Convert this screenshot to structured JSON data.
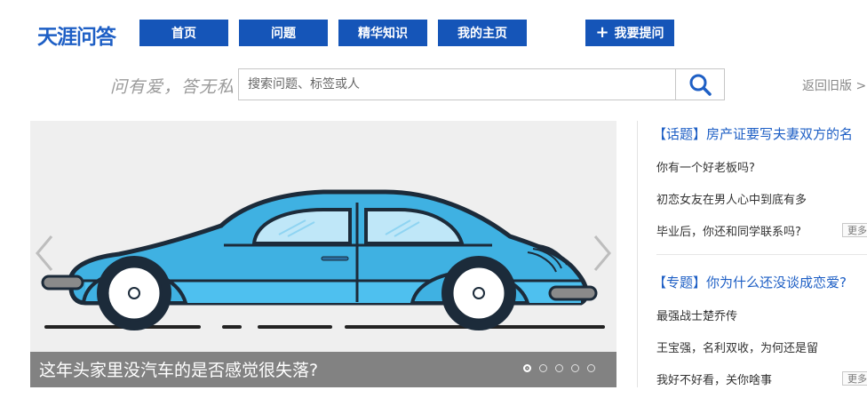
{
  "logo": "天涯问答",
  "nav": {
    "home": "首页",
    "questions": "问题",
    "featured": "精华知识",
    "my_home": "我的主页",
    "ask": "我要提问",
    "ask_icon": "plus-icon"
  },
  "slogan": "问有爱，答无私",
  "search": {
    "placeholder": "搜索问题、标签或人",
    "value": "",
    "icon": "search-icon"
  },
  "old_version": "返回旧版 >>",
  "carousel": {
    "caption": "这年头家里没汽车的是否感觉很失落?",
    "slide_count": 5,
    "active_index": 0,
    "image": "blue-car-illustration"
  },
  "side": {
    "topic": {
      "title": "【话题】房产证要写夫妻双方的名",
      "items": [
        "你有一个好老板吗?",
        "初恋女友在男人心中到底有多",
        "毕业后，你还和同学联系吗?"
      ],
      "more": "更多"
    },
    "special": {
      "title": "【专题】你为什么还没谈成恋爱?",
      "items": [
        "最强战士楚乔传",
        "王宝强，名利双收，为何还是留",
        "我好不好看，关你啥事"
      ],
      "more": "更多"
    }
  },
  "colors": {
    "brand_blue": "#1555b8",
    "link_blue": "#1e5fc5",
    "car_blue": "#3fb1e2"
  }
}
